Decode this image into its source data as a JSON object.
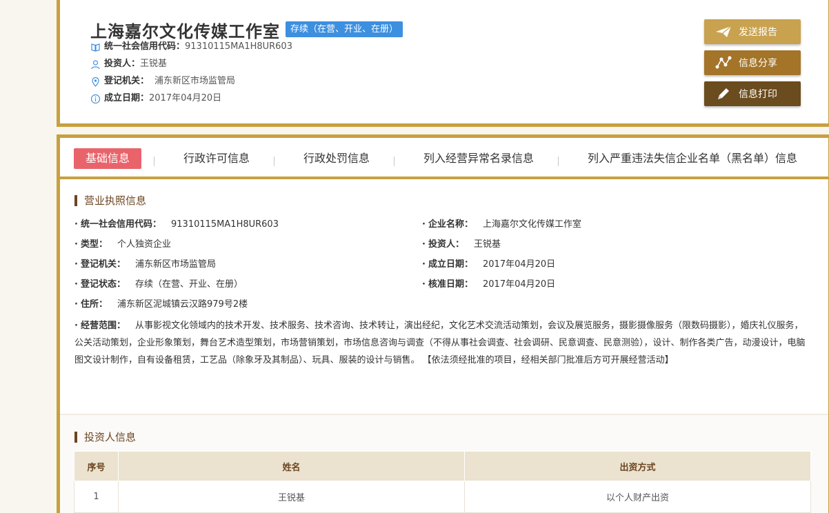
{
  "header": {
    "company_name": "上海嘉尔文化传媒工作室",
    "status_tag": "存续（在营、开业、在册）",
    "rows": [
      {
        "icon": "book-icon",
        "label": "统一社会信用代码：",
        "value": "91310115MA1H8UR603"
      },
      {
        "icon": "user-icon",
        "label": "投资人：",
        "value": "王锐基"
      },
      {
        "icon": "location-pin-icon",
        "label": "登记机关：",
        "value": "浦东新区市场监管局"
      },
      {
        "icon": "info-icon",
        "label": "成立日期：",
        "value": "2017年04月20日"
      }
    ],
    "buttons": {
      "report": "发送报告",
      "share": "信息分享",
      "print": "信息打印"
    }
  },
  "tabs": [
    {
      "label": "基础信息",
      "active": true
    },
    {
      "label": "行政许可信息"
    },
    {
      "label": "行政处罚信息"
    },
    {
      "label": "列入经营异常名录信息"
    },
    {
      "label": "列入严重违法失信企业名单（黑名单）信息"
    }
  ],
  "license": {
    "section_title": "营业执照信息",
    "credit_code": {
      "label": "统一社会信用代码：",
      "value": "91310115MA1H8UR603"
    },
    "company_name": {
      "label": "企业名称：",
      "value": "上海嘉尔文化传媒工作室"
    },
    "type": {
      "label": "类型：",
      "value": "个人独资企业"
    },
    "investor": {
      "label": "投资人：",
      "value": "王锐基"
    },
    "authority": {
      "label": "登记机关：",
      "value": "浦东新区市场监管局"
    },
    "established": {
      "label": "成立日期：",
      "value": "2017年04月20日"
    },
    "reg_status": {
      "label": "登记状态：",
      "value": "存续（在营、开业、在册）"
    },
    "approved": {
      "label": "核准日期：",
      "value": "2017年04月20日"
    },
    "address": {
      "label": "住所：",
      "value": "浦东新区泥城镇云汉路979号2楼"
    },
    "scope": {
      "label": "经营范围：",
      "value": "从事影视文化领域内的技术开发、技术服务、技术咨询、技术转让，演出经纪，文化艺术交流活动策划，会议及展览服务，摄影摄像服务（限数码摄影），婚庆礼仪服务，公关活动策划，企业形象策划，舞台艺术造型策划，市场营销策划，市场信息咨询与调查（不得从事社会调查、社会调研、民意调查、民意测验），设计、制作各类广告，动漫设计，电脑图文设计制作，自有设备租赁，工艺品（除象牙及其制品）、玩具、服装的设计与销售。 【依法须经批准的项目，经相关部门批准后方可开展经营活动】"
    }
  },
  "investors": {
    "section_title": "投资人信息",
    "columns": [
      "序号",
      "姓名",
      "出资方式"
    ],
    "rows": [
      [
        "1",
        "王锐基",
        "以个人财产出资"
      ]
    ]
  }
}
